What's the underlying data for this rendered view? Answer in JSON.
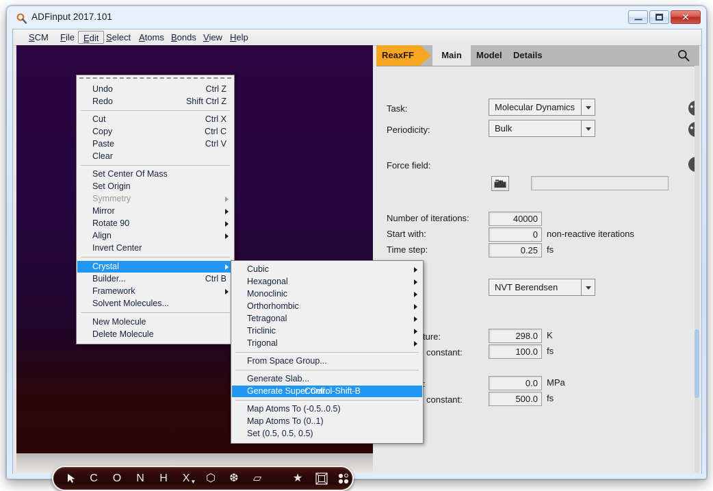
{
  "window": {
    "title": "ADFinput 2017.101",
    "icon": "app-magnifier-icon",
    "buttons": {
      "minimize": "–",
      "maximize": "❐",
      "close": "✕"
    }
  },
  "menubar": {
    "items": [
      {
        "label": "SCM",
        "mnemonic": "S",
        "active": false
      },
      {
        "label": "File",
        "mnemonic": "F",
        "active": false
      },
      {
        "label": "Edit",
        "mnemonic": "E",
        "active": true
      },
      {
        "label": "Select",
        "mnemonic": "S",
        "active": false
      },
      {
        "label": "Atoms",
        "mnemonic": "A",
        "active": false
      },
      {
        "label": "Bonds",
        "mnemonic": "B",
        "active": false
      },
      {
        "label": "View",
        "mnemonic": "V",
        "active": false
      },
      {
        "label": "Help",
        "mnemonic": "H",
        "active": false
      }
    ]
  },
  "edit_menu": {
    "items": [
      {
        "label": "Undo",
        "accel": "Ctrl Z",
        "submenu": false,
        "disabled": false,
        "selected": false
      },
      {
        "label": "Redo",
        "accel": "Shift Ctrl Z",
        "submenu": false,
        "disabled": false,
        "selected": false
      },
      {
        "separator": true
      },
      {
        "label": "Cut",
        "accel": "Ctrl X",
        "submenu": false,
        "disabled": false,
        "selected": false
      },
      {
        "label": "Copy",
        "accel": "Ctrl C",
        "submenu": false,
        "disabled": false,
        "selected": false
      },
      {
        "label": "Paste",
        "accel": "Ctrl V",
        "submenu": false,
        "disabled": false,
        "selected": false
      },
      {
        "label": "Clear",
        "accel": "",
        "submenu": false,
        "disabled": false,
        "selected": false
      },
      {
        "separator": true
      },
      {
        "label": "Set Center Of Mass",
        "accel": "",
        "submenu": false,
        "disabled": false,
        "selected": false
      },
      {
        "label": "Set Origin",
        "accel": "",
        "submenu": false,
        "disabled": false,
        "selected": false
      },
      {
        "label": "Symmetry",
        "accel": "",
        "submenu": true,
        "disabled": true,
        "selected": false
      },
      {
        "label": "Mirror",
        "accel": "",
        "submenu": true,
        "disabled": false,
        "selected": false
      },
      {
        "label": "Rotate 90",
        "accel": "",
        "submenu": true,
        "disabled": false,
        "selected": false
      },
      {
        "label": "Align",
        "accel": "",
        "submenu": true,
        "disabled": false,
        "selected": false
      },
      {
        "label": "Invert Center",
        "accel": "",
        "submenu": false,
        "disabled": false,
        "selected": false
      },
      {
        "separator": true
      },
      {
        "label": "Crystal",
        "accel": "",
        "submenu": true,
        "disabled": false,
        "selected": true
      },
      {
        "label": "Builder...",
        "accel": "Ctrl B",
        "submenu": false,
        "disabled": false,
        "selected": false
      },
      {
        "label": "Framework",
        "accel": "",
        "submenu": true,
        "disabled": false,
        "selected": false
      },
      {
        "label": "Solvent Molecules...",
        "accel": "",
        "submenu": false,
        "disabled": false,
        "selected": false
      },
      {
        "separator": true
      },
      {
        "label": "New Molecule",
        "accel": "",
        "submenu": false,
        "disabled": false,
        "selected": false
      },
      {
        "label": "Delete Molecule",
        "accel": "",
        "submenu": false,
        "disabled": false,
        "selected": false
      }
    ]
  },
  "crystal_menu": {
    "items": [
      {
        "label": "Cubic",
        "accel": "",
        "submenu": true,
        "selected": false
      },
      {
        "label": "Hexagonal",
        "accel": "",
        "submenu": true,
        "selected": false
      },
      {
        "label": "Monoclinic",
        "accel": "",
        "submenu": true,
        "selected": false
      },
      {
        "label": "Orthorhombic",
        "accel": "",
        "submenu": true,
        "selected": false
      },
      {
        "label": "Tetragonal",
        "accel": "",
        "submenu": true,
        "selected": false
      },
      {
        "label": "Triclinic",
        "accel": "",
        "submenu": true,
        "selected": false
      },
      {
        "label": "Trigonal",
        "accel": "",
        "submenu": true,
        "selected": false
      },
      {
        "separator": true
      },
      {
        "label": "From Space Group...",
        "accel": "",
        "submenu": false,
        "selected": false
      },
      {
        "separator": true
      },
      {
        "label": "Generate Slab...",
        "accel": "",
        "submenu": false,
        "selected": false
      },
      {
        "label": "Generate Super Cell...",
        "accel": "Control-Shift-B",
        "submenu": false,
        "selected": true
      },
      {
        "separator": true
      },
      {
        "label": "Map Atoms To (-0.5..0.5)",
        "accel": "",
        "submenu": false,
        "selected": false
      },
      {
        "label": "Map Atoms To (0..1)",
        "accel": "",
        "submenu": false,
        "selected": false
      },
      {
        "label": "Set (0.5, 0.5, 0.5)",
        "accel": "",
        "submenu": false,
        "selected": false
      }
    ]
  },
  "panel": {
    "tabs": {
      "brand": "ReaxFF",
      "main": "Main",
      "model": "Model",
      "details": "Details"
    },
    "search_icon": "search-icon",
    "task": {
      "label": "Task:",
      "value": "Molecular Dynamics"
    },
    "periodicity": {
      "label": "Periodicity:",
      "value": "Bulk"
    },
    "force_field": {
      "label": "Force field:",
      "value": "",
      "browse_icon": "folder-icon"
    },
    "iterations": {
      "label": "Number of iterations:",
      "value": "40000"
    },
    "start_with": {
      "label": "Start with:",
      "value": "0",
      "unit": "non-reactive iterations"
    },
    "time_step": {
      "label": "Time step:",
      "value": "0.25",
      "unit": "fs"
    },
    "ensemble": {
      "value": "NVT Berendsen"
    },
    "temperature": {
      "label": "ture:",
      "value": "298.0",
      "unit": "K"
    },
    "temp_constant": {
      "label": "constant:",
      "value": "100.0",
      "unit": "fs"
    },
    "pressure": {
      "label": ":",
      "value": "0.0",
      "unit": "MPa"
    },
    "press_constant": {
      "label": "constant:",
      "value": "500.0",
      "unit": "fs"
    },
    "info_icon": "info-icon",
    "more_icon": "ellipsis-icon"
  },
  "atom_toolbar": {
    "items": [
      {
        "name": "select-arrow-icon",
        "label": "➤"
      },
      {
        "name": "carbon-tool",
        "label": "C"
      },
      {
        "name": "oxygen-tool",
        "label": "O"
      },
      {
        "name": "nitrogen-tool",
        "label": "N"
      },
      {
        "name": "hydrogen-tool",
        "label": "H"
      },
      {
        "name": "other-element-tool",
        "label": "X"
      },
      {
        "name": "ring-tool",
        "label": "⬡"
      },
      {
        "name": "snowflake-tool",
        "label": "❆"
      },
      {
        "name": "plane-tool",
        "label": "▱"
      },
      {
        "name": "star-tool",
        "label": "★"
      },
      {
        "name": "box-tool",
        "label": "▣"
      },
      {
        "name": "points-tool",
        "label": "⁙"
      }
    ]
  },
  "colors": {
    "accent_orange": "#f5a623",
    "menu_highlight": "#2196f3",
    "viewport_top": "#2b0642",
    "viewport_bottom": "#2b0505",
    "titlebar": "#dceafa"
  }
}
